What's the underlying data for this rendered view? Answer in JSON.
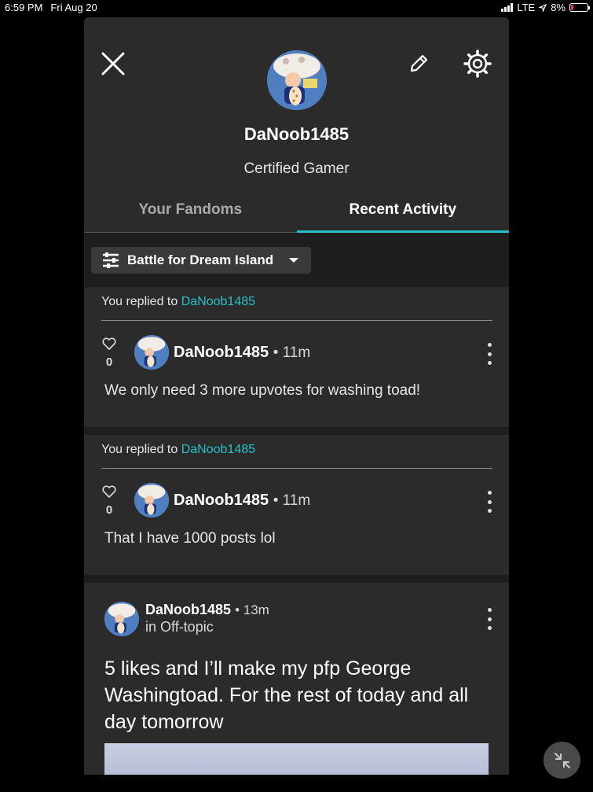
{
  "status_bar": {
    "time": "6:59 PM",
    "date": "Fri Aug 20",
    "network": "LTE",
    "battery": "8%"
  },
  "profile": {
    "username": "DaNoob1485",
    "tagline": "Certified Gamer"
  },
  "tabs": [
    {
      "label": "Your Fandoms"
    },
    {
      "label": "Recent Activity"
    }
  ],
  "filter": {
    "label": "Battle for Dream Island"
  },
  "activity": [
    {
      "reply_prefix": "You replied to",
      "reply_target": "DaNoob1485",
      "likes": "0",
      "author": "DaNoob1485",
      "time": "• 11m",
      "body": "We only need 3 more upvotes for washing toad!"
    },
    {
      "reply_prefix": "You replied to",
      "reply_target": "DaNoob1485",
      "likes": "0",
      "author": "DaNoob1485",
      "time": "• 11m",
      "body": "That I have 1000 posts lol"
    }
  ],
  "post": {
    "author": "DaNoob1485",
    "time": "• 13m",
    "community": "in Off-topic",
    "body": "5 likes and I’ll make my pfp George Washingtoad. For the rest of today and all day tomorrow"
  },
  "colors": {
    "accent": "#27c2c7",
    "panel": "#2b2b2b",
    "background": "#000000"
  }
}
